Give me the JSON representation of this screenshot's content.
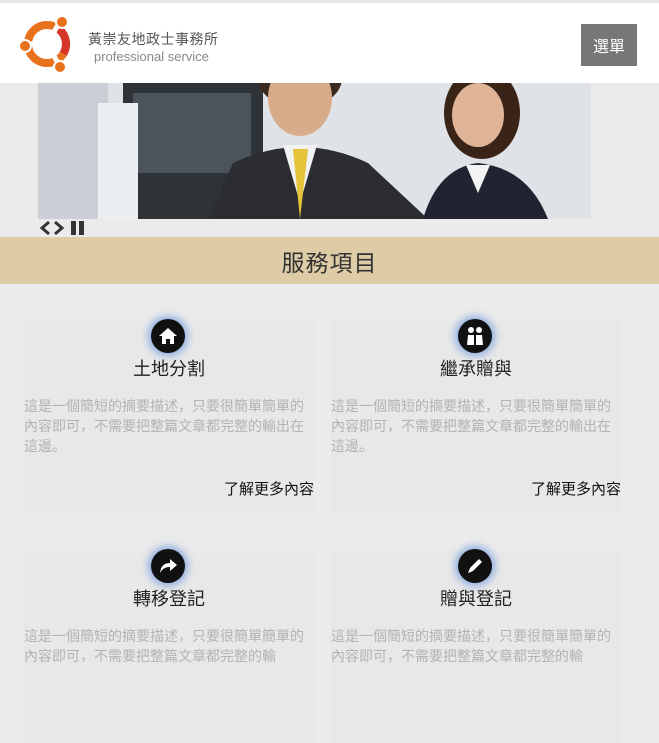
{
  "header": {
    "brand_name": "黃崇友地政士事務所",
    "brand_tagline": "professional service",
    "menu_label": "選單"
  },
  "section": {
    "title": "服務項目"
  },
  "services": [
    {
      "title": "土地分割",
      "icon": "home-icon",
      "desc": "這是一個簡短的摘要描述，只要很簡單簡單的內容即可，不需要把整篇文章都完整的輸出在這邊。",
      "more": "了解更多內容"
    },
    {
      "title": "繼承贈與",
      "icon": "people-icon",
      "desc": "這是一個簡短的摘要描述，只要很簡單簡單的內容即可，不需要把整篇文章都完整的輸出在這邊。",
      "more": "了解更多內容"
    },
    {
      "title": "轉移登記",
      "icon": "share-arrow-icon",
      "desc": "這是一個簡短的摘要描述，只要很簡單簡單的內容即可，不需要把整篇文章都完整的輸",
      "more": ""
    },
    {
      "title": "贈與登記",
      "icon": "pencil-icon",
      "desc": "這是一個簡短的摘要描述，只要很簡單簡單的內容即可，不需要把整篇文章都完整的輸",
      "more": ""
    }
  ],
  "colors": {
    "section_band": "#ddcca6",
    "menu_button": "#777777",
    "logo_orange": "#e8711c",
    "logo_red": "#d4362a",
    "icon_glow": "#5a8cdc"
  }
}
